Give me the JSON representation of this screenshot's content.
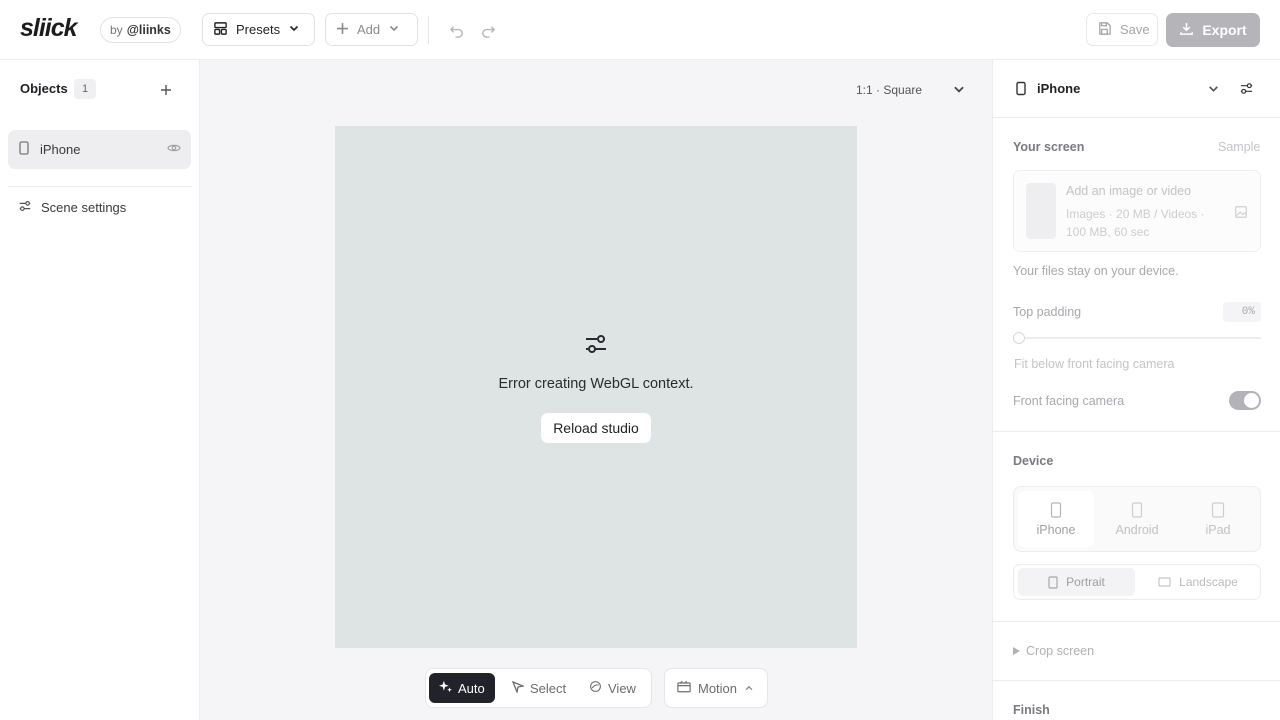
{
  "header": {
    "logo": "sliick",
    "by_label": "by",
    "by_brand": "@liinks",
    "presets_label": "Presets",
    "add_label": "Add",
    "save_label": "Save",
    "export_label": "Export"
  },
  "objects_panel": {
    "title": "Objects",
    "count": "1",
    "items": [
      {
        "label": "iPhone"
      }
    ],
    "scene_settings_label": "Scene settings"
  },
  "canvas": {
    "aspect_ratio": "1:1 · Square",
    "error_message": "Error creating WebGL context.",
    "reload_label": "Reload studio",
    "tools": {
      "auto": "Auto",
      "select": "Select",
      "view": "View"
    },
    "motion_label": "Motion"
  },
  "inspector": {
    "title": "iPhone",
    "your_screen": {
      "title": "Your screen",
      "sample_label": "Sample",
      "upload_title": "Add an image or video",
      "upload_sub": "Images · 20 MB / Videos · 100 MB, 60 sec",
      "note": "Your files stay on your device."
    },
    "top_padding": {
      "label": "Top padding",
      "value": "0%",
      "hint": "Fit below front facing camera"
    },
    "front_camera": {
      "label": "Front facing camera",
      "enabled": true
    },
    "device": {
      "title": "Device",
      "options": [
        "iPhone",
        "Android",
        "iPad"
      ],
      "selected": "iPhone",
      "orientations": [
        "Portrait",
        "Landscape"
      ],
      "orientation_selected": "Portrait"
    },
    "crop_label": "Crop screen",
    "finish_label": "Finish"
  },
  "colors": {
    "accent_dark": "#22222a",
    "export_bg": "#b4b4b9",
    "stage_bg": "#dde4e3"
  }
}
